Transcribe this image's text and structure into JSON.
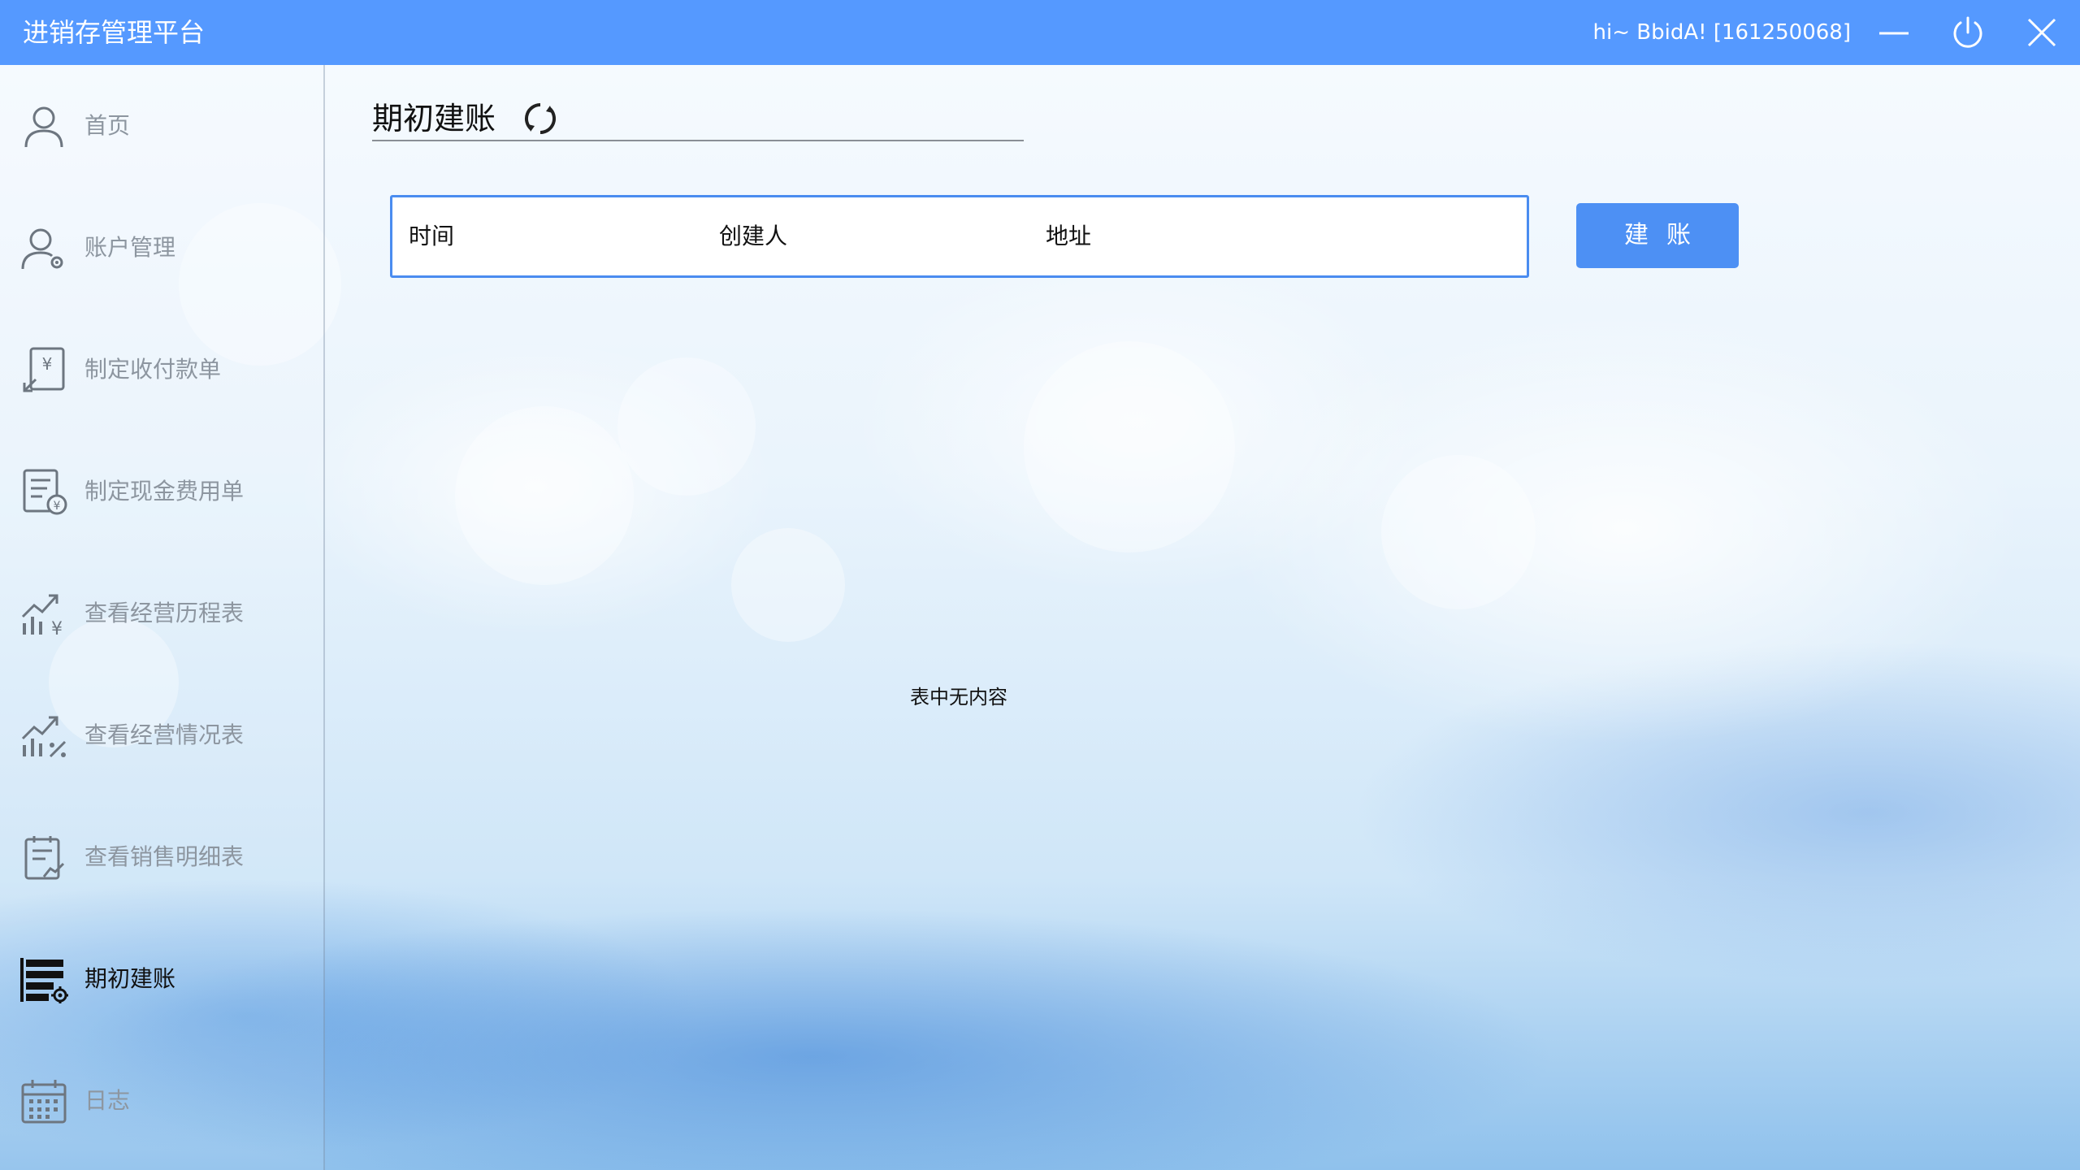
{
  "window": {
    "title": "进销存管理平台",
    "user_label": "hi~ BbidA! [161250068]"
  },
  "sidebar": {
    "items": [
      {
        "label": "首页",
        "icon": "user-icon"
      },
      {
        "label": "账户管理",
        "icon": "user-settings-icon"
      },
      {
        "label": "制定收付款单",
        "icon": "payment-icon"
      },
      {
        "label": "制定现金费用单",
        "icon": "cash-bill-icon"
      },
      {
        "label": "查看经营历程表",
        "icon": "chart-yen-icon"
      },
      {
        "label": "查看经营情况表",
        "icon": "chart-percent-icon"
      },
      {
        "label": "查看销售明细表",
        "icon": "clipboard-chart-icon"
      },
      {
        "label": "期初建账",
        "icon": "list-settings-icon",
        "active": true
      },
      {
        "label": "日志",
        "icon": "calendar-icon"
      }
    ]
  },
  "main": {
    "title": "期初建账",
    "table": {
      "columns": [
        "时间",
        "创建人",
        "地址"
      ],
      "empty_text": "表中无内容"
    },
    "create_button": "建账"
  },
  "colors": {
    "titlebar": "#5599ff",
    "accent": "#4d90f4"
  }
}
